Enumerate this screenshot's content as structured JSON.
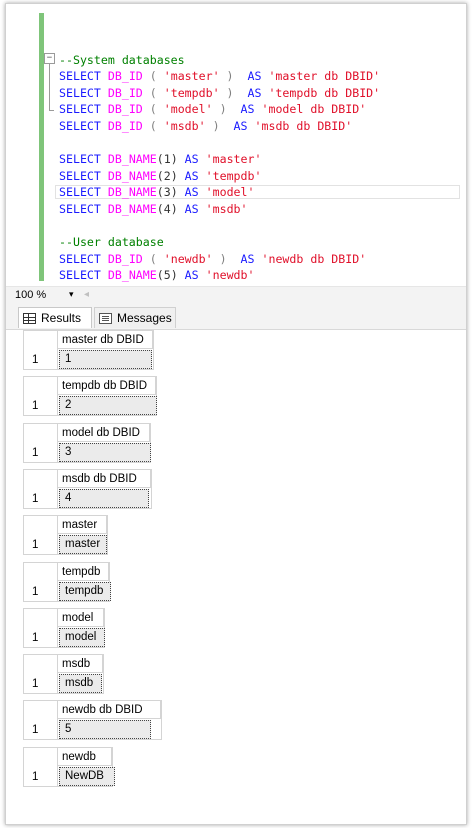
{
  "editor": {
    "lines": [
      [],
      [
        {
          "t": "--System databases",
          "c": "cm"
        }
      ],
      [
        {
          "t": "SELECT ",
          "c": "kw"
        },
        {
          "t": "DB_ID",
          "c": "fn"
        },
        {
          "t": " ( ",
          "c": "gr"
        },
        {
          "t": "'master'",
          "c": "st"
        },
        {
          "t": " )  ",
          "c": "gr"
        },
        {
          "t": "AS ",
          "c": "kw"
        },
        {
          "t": "'master db DBID'",
          "c": "st"
        }
      ],
      [
        {
          "t": "SELECT ",
          "c": "kw"
        },
        {
          "t": "DB_ID",
          "c": "fn"
        },
        {
          "t": " ( ",
          "c": "gr"
        },
        {
          "t": "'tempdb'",
          "c": "st"
        },
        {
          "t": " )  ",
          "c": "gr"
        },
        {
          "t": "AS ",
          "c": "kw"
        },
        {
          "t": "'tempdb db DBID'",
          "c": "st"
        }
      ],
      [
        {
          "t": "SELECT ",
          "c": "kw"
        },
        {
          "t": "DB_ID",
          "c": "fn"
        },
        {
          "t": " ( ",
          "c": "gr"
        },
        {
          "t": "'model'",
          "c": "st"
        },
        {
          "t": " )  ",
          "c": "gr"
        },
        {
          "t": "AS ",
          "c": "kw"
        },
        {
          "t": "'model db DBID'",
          "c": "st"
        }
      ],
      [
        {
          "t": "SELECT ",
          "c": "kw"
        },
        {
          "t": "DB_ID",
          "c": "fn"
        },
        {
          "t": " ( ",
          "c": "gr"
        },
        {
          "t": "'msdb'",
          "c": "st"
        },
        {
          "t": " )  ",
          "c": "gr"
        },
        {
          "t": "AS ",
          "c": "kw"
        },
        {
          "t": "'msdb db DBID'",
          "c": "st"
        }
      ],
      [],
      [
        {
          "t": "SELECT ",
          "c": "kw"
        },
        {
          "t": "DB_NAME",
          "c": "fn"
        },
        {
          "t": "(1) ",
          "c": "pl"
        },
        {
          "t": "AS ",
          "c": "kw"
        },
        {
          "t": "'master'",
          "c": "st"
        }
      ],
      [
        {
          "t": "SELECT ",
          "c": "kw"
        },
        {
          "t": "DB_NAME",
          "c": "fn"
        },
        {
          "t": "(2) ",
          "c": "pl"
        },
        {
          "t": "AS ",
          "c": "kw"
        },
        {
          "t": "'tempdb'",
          "c": "st"
        }
      ],
      [
        {
          "t": "SELECT ",
          "c": "kw"
        },
        {
          "t": "DB_NAME",
          "c": "fn"
        },
        {
          "t": "(3) ",
          "c": "pl"
        },
        {
          "t": "AS ",
          "c": "kw"
        },
        {
          "t": "'model'",
          "c": "st"
        }
      ],
      [
        {
          "t": "SELECT ",
          "c": "kw"
        },
        {
          "t": "DB_NAME",
          "c": "fn"
        },
        {
          "t": "(4) ",
          "c": "pl"
        },
        {
          "t": "AS ",
          "c": "kw"
        },
        {
          "t": "'msdb'",
          "c": "st"
        }
      ],
      [],
      [
        {
          "t": "--User database",
          "c": "cm"
        }
      ],
      [
        {
          "t": "SELECT ",
          "c": "kw"
        },
        {
          "t": "DB_ID",
          "c": "fn"
        },
        {
          "t": " ( ",
          "c": "gr"
        },
        {
          "t": "'newdb'",
          "c": "st"
        },
        {
          "t": " )  ",
          "c": "gr"
        },
        {
          "t": "AS ",
          "c": "kw"
        },
        {
          "t": "'newdb db DBID'",
          "c": "st"
        }
      ],
      [
        {
          "t": "SELECT ",
          "c": "kw"
        },
        {
          "t": "DB_NAME",
          "c": "fn"
        },
        {
          "t": "(5) ",
          "c": "pl"
        },
        {
          "t": "AS ",
          "c": "kw"
        },
        {
          "t": "'newdb'",
          "c": "st"
        }
      ]
    ]
  },
  "zoom": {
    "value": "100 %",
    "arrow": "▾",
    "scroll_left": "◂"
  },
  "tabs": {
    "results": "Results",
    "messages": "Messages"
  },
  "results": [
    {
      "header": "master db DBID",
      "row": "1",
      "value": "1"
    },
    {
      "header": "tempdb db DBID",
      "row": "1",
      "value": "2"
    },
    {
      "header": "model db DBID",
      "row": "1",
      "value": "3"
    },
    {
      "header": "msdb db DBID",
      "row": "1",
      "value": "4"
    },
    {
      "header": "master",
      "row": "1",
      "value": "master"
    },
    {
      "header": "tempdb",
      "row": "1",
      "value": "tempdb"
    },
    {
      "header": "model",
      "row": "1",
      "value": "model"
    },
    {
      "header": "msdb",
      "row": "1",
      "value": "msdb"
    },
    {
      "header": "newdb db DBID",
      "row": "1",
      "value": "5"
    },
    {
      "header": "newdb",
      "row": "1",
      "value": "NewDB"
    }
  ]
}
